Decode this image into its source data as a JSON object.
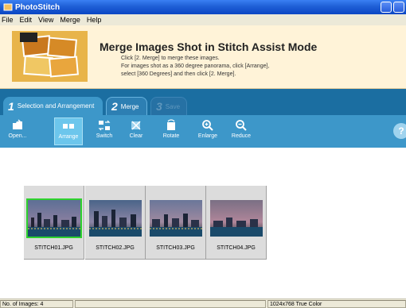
{
  "window": {
    "title": "PhotoStitch"
  },
  "menu": [
    "File",
    "Edit",
    "View",
    "Merge",
    "Help"
  ],
  "banner": {
    "title": "Merge Images Shot in Stitch Assist Mode",
    "lines": [
      "Click [2. Merge] to merge these images.",
      "For images shot as a 360 degree panorama, click [Arrange],",
      "select [360 Degrees] and then click [2. Merge]."
    ]
  },
  "tabs": [
    {
      "num": "1",
      "label": "Selection and Arrangement"
    },
    {
      "num": "2",
      "label": "Merge"
    },
    {
      "num": "3",
      "label": "Save"
    }
  ],
  "toolbar": [
    {
      "label": "Open...",
      "icon": "open-icon"
    },
    {
      "label": "Arrange",
      "icon": "arrange-icon",
      "active": true
    },
    {
      "label": "Switch",
      "icon": "switch-icon"
    },
    {
      "label": "Clear",
      "icon": "clear-icon"
    },
    {
      "label": "Rotate",
      "icon": "rotate-icon"
    },
    {
      "label": "Enlarge",
      "icon": "zoom-in-icon"
    },
    {
      "label": "Reduce",
      "icon": "zoom-out-icon"
    }
  ],
  "images": [
    {
      "filename": "STITCH01.JPG",
      "selected": true
    },
    {
      "filename": "STITCH02.JPG",
      "selected": false
    },
    {
      "filename": "STITCH03.JPG",
      "selected": false
    },
    {
      "filename": "STITCH04.JPG",
      "selected": false
    }
  ],
  "status": {
    "count": "No. of Images: 4",
    "info": "1024x768 True Color"
  }
}
